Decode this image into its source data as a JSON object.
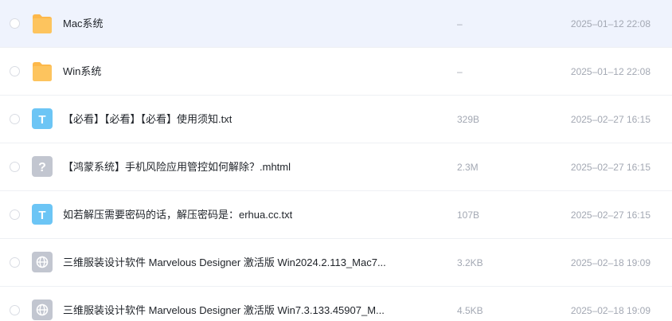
{
  "colors": {
    "selected_row_bg": "#eff3fd",
    "folder": "#fdc45e",
    "text_file": "#6cc5f5",
    "unknown_file": "#c2c6d0",
    "web_file": "#c2c6d0",
    "secondary_text": "#a3a8b3"
  },
  "files": [
    {
      "name": "Mac系统",
      "size": "–",
      "date": "2025–01–12 22:08",
      "icon": "folder-icon",
      "selected": true
    },
    {
      "name": "Win系统",
      "size": "–",
      "date": "2025–01–12 22:08",
      "icon": "folder-icon",
      "selected": false
    },
    {
      "name": "【必看】【必看】【必看】使用须知.txt",
      "size": "329B",
      "date": "2025–02–27 16:15",
      "icon": "text-file-icon",
      "icon_letter": "T",
      "selected": false
    },
    {
      "name": "【鸿蒙系统】手机风险应用管控如何解除？.mhtml",
      "size": "2.3M",
      "date": "2025–02–27 16:15",
      "icon": "unknown-file-icon",
      "icon_letter": "?",
      "selected": false
    },
    {
      "name": "如若解压需要密码的话，解压密码是：erhua.cc.txt",
      "size": "107B",
      "date": "2025–02–27 16:15",
      "icon": "text-file-icon",
      "icon_letter": "T",
      "selected": false
    },
    {
      "name": "三维服装设计软件 Marvelous Designer 激活版 Win2024.2.113_Mac7...",
      "size": "3.2KB",
      "date": "2025–02–18 19:09",
      "icon": "web-link-icon",
      "selected": false
    },
    {
      "name": "三维服装设计软件 Marvelous Designer 激活版 Win7.3.133.45907_M...",
      "size": "4.5KB",
      "date": "2025–02–18 19:09",
      "icon": "web-link-icon",
      "selected": false
    }
  ]
}
